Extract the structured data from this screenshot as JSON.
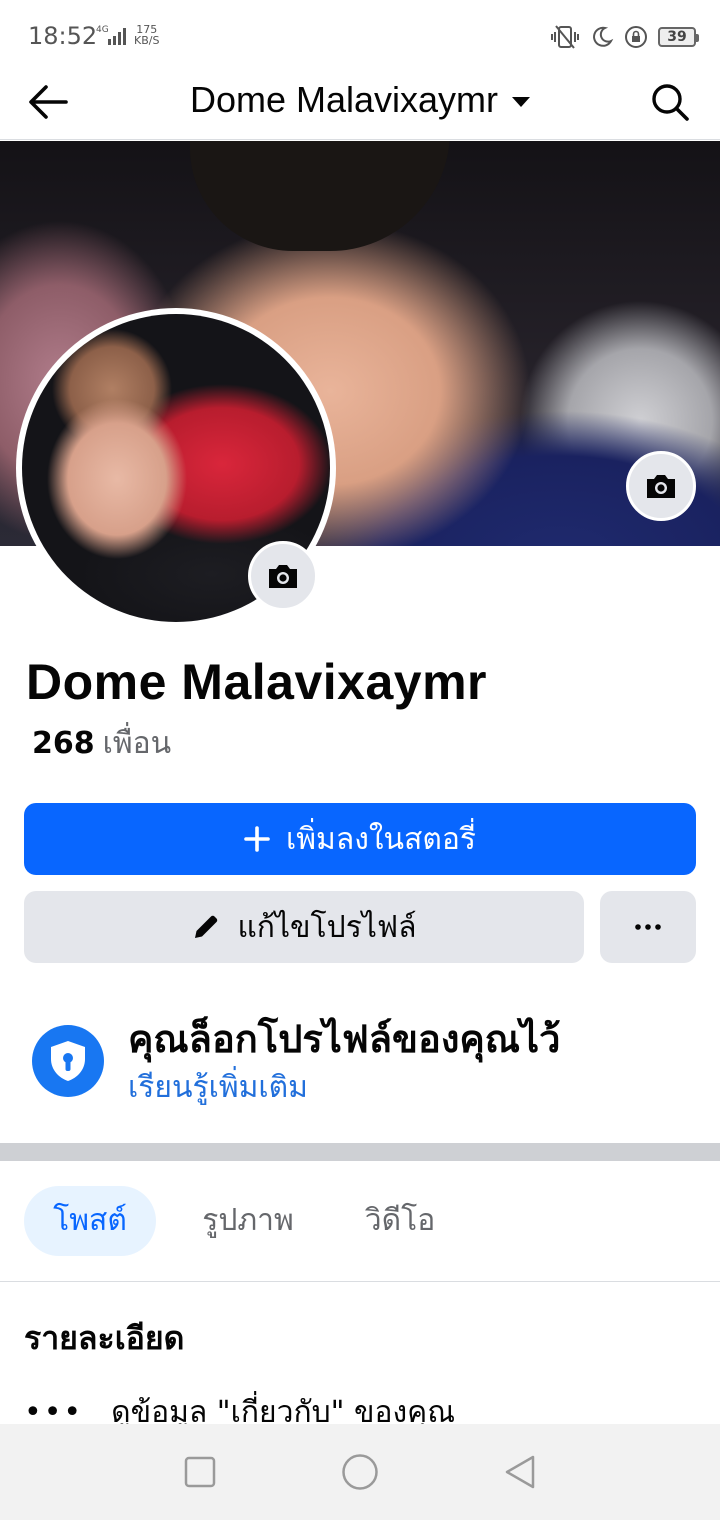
{
  "status_bar": {
    "time": "18:52",
    "network": "4G",
    "speed_value": "175",
    "speed_unit": "KB/S",
    "battery": "39"
  },
  "header": {
    "title": "Dome Malavixaymr"
  },
  "profile": {
    "name": "Dome Malavixaymr",
    "friends_count": "268",
    "friends_label": "เพื่อน"
  },
  "actions": {
    "add_story_label": "เพิ่มลงในสตอรี่",
    "edit_profile_label": "แก้ไขโปรไฟล์",
    "more_label": "···"
  },
  "lock_notice": {
    "title": "คุณล็อกโปรไฟล์ของคุณไว้",
    "link": "เรียนรู้เพิ่มเติม"
  },
  "tabs": [
    {
      "label": "โพสต์",
      "active": true
    },
    {
      "label": "รูปภาพ",
      "active": false
    },
    {
      "label": "วิดีโอ",
      "active": false
    }
  ],
  "details": {
    "title": "รายละเอียด",
    "row_text": "ดูข้อมูล \"เกี่ยวกับ\" ของคุณ"
  },
  "colors": {
    "primary": "#0866ff",
    "secondary_button": "#e4e6eb",
    "link": "#216fdb",
    "active_tab_bg": "#e7f3ff"
  },
  "icons": [
    "back-arrow-icon",
    "search-icon",
    "camera-icon",
    "plus-icon",
    "pencil-icon",
    "more-dots-icon",
    "shield-lock-icon",
    "nav-square-icon",
    "nav-circle-icon",
    "nav-triangle-icon"
  ]
}
